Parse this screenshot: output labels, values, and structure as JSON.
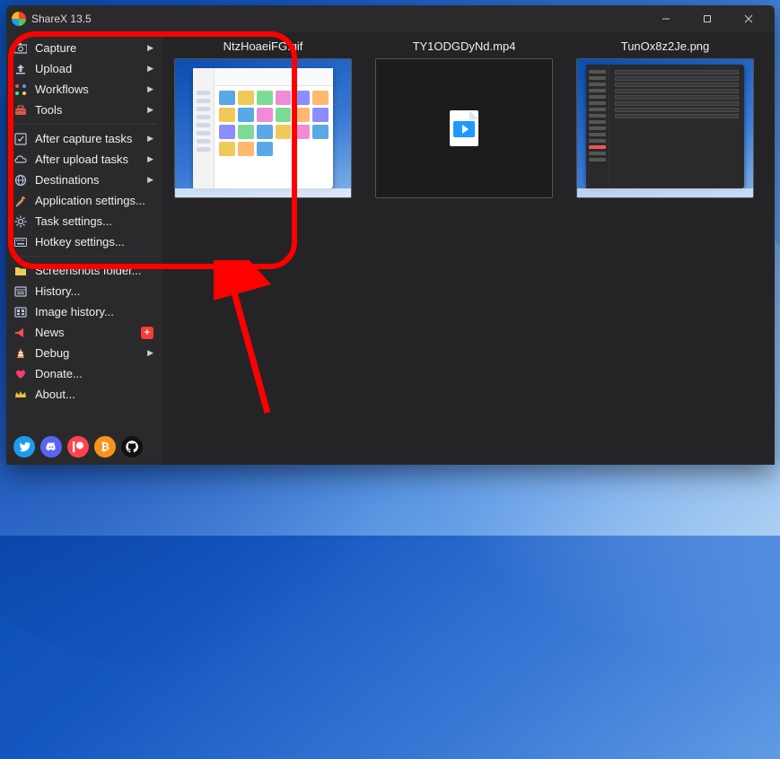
{
  "titlebar": {
    "title": "ShareX 13.5"
  },
  "sidebar_groups": [
    [
      {
        "icon": "capture",
        "label": "Capture",
        "submenu": true
      },
      {
        "icon": "upload",
        "label": "Upload",
        "submenu": true
      },
      {
        "icon": "workflows",
        "label": "Workflows",
        "submenu": true
      },
      {
        "icon": "tools",
        "label": "Tools",
        "submenu": true
      }
    ],
    [
      {
        "icon": "after-capture",
        "label": "After capture tasks",
        "submenu": true
      },
      {
        "icon": "after-upload",
        "label": "After upload tasks",
        "submenu": true
      },
      {
        "icon": "destinations",
        "label": "Destinations",
        "submenu": true
      },
      {
        "icon": "app-settings",
        "label": "Application settings..."
      },
      {
        "icon": "task-settings",
        "label": "Task settings..."
      },
      {
        "icon": "hotkey-settings",
        "label": "Hotkey settings..."
      }
    ],
    [
      {
        "icon": "folder",
        "label": "Screenshots folder..."
      },
      {
        "icon": "history",
        "label": "History..."
      },
      {
        "icon": "image-history",
        "label": "Image history..."
      },
      {
        "icon": "news",
        "label": "News",
        "badge": "+"
      },
      {
        "icon": "debug",
        "label": "Debug",
        "submenu": true
      },
      {
        "icon": "donate",
        "label": "Donate..."
      },
      {
        "icon": "about",
        "label": "About..."
      }
    ]
  ],
  "thumbnails": [
    {
      "filename": "NtzHoaeiFG.gif",
      "kind": "screenshot-explorer"
    },
    {
      "filename": "TY1ODGDyNd.mp4",
      "kind": "video"
    },
    {
      "filename": "TunOx8z2Je.png",
      "kind": "screenshot-dark"
    }
  ]
}
